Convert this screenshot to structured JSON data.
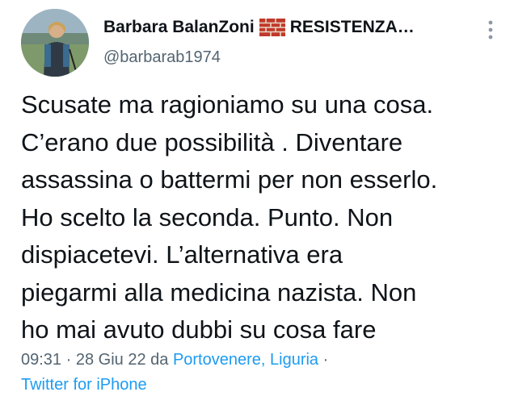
{
  "author": {
    "display_name": "Barbara BalanZoni",
    "display_name_suffix": "RESISTENZA…",
    "handle": "@barbarab1974",
    "avatar_icon": "profile-photo-hiker",
    "name_emoji_icon": "brick-icon"
  },
  "menu": {
    "icon": "more-vertical-icon"
  },
  "tweet": {
    "text": "Scusate ma ragioniamo su una cosa.\nC’erano due possibilità . Diventare\nassassina o battermi per non esserlo.\nHo scelto la seconda. Punto. Non\ndispiacetevi. L’alternativa era\npiegarmi alla medicina nazista. Non\nho mai avuto dubbi su cosa fare"
  },
  "meta": {
    "time": "09:31",
    "separator": " · ",
    "date": "28 Giu 22",
    "location_prefix": " da ",
    "location": "Portovenere, Liguria",
    "separator2": " ·",
    "source": "Twitter for iPhone"
  },
  "colors": {
    "text": "#0f1419",
    "secondary": "#536471",
    "link": "#1d9bf0",
    "background": "#ffffff"
  }
}
